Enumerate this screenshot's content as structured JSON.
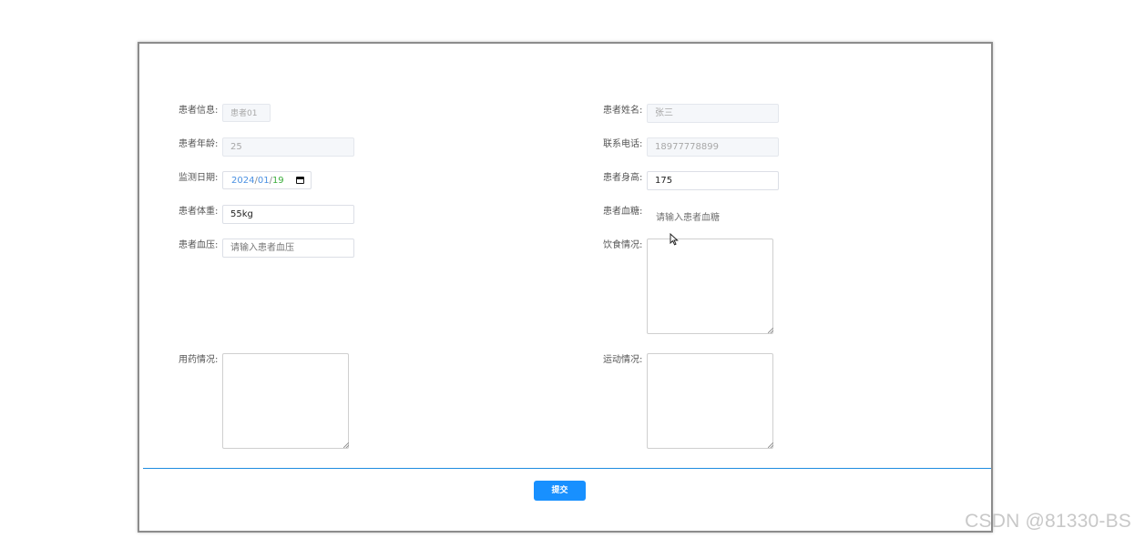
{
  "form": {
    "patient_info": {
      "label": "患者信息:",
      "value": "患者01"
    },
    "patient_name": {
      "label": "患者姓名:",
      "value": "张三"
    },
    "patient_age": {
      "label": "患者年龄:",
      "value": "25"
    },
    "contact_phone": {
      "label": "联系电话:",
      "value": "18977778899"
    },
    "monitor_date": {
      "label": "监测日期:",
      "year": "2024",
      "month": "01",
      "day": "19",
      "separator": "/"
    },
    "patient_height": {
      "label": "患者身高:",
      "value": "175"
    },
    "patient_weight": {
      "label": "患者体重:",
      "value": "55kg"
    },
    "blood_sugar": {
      "label": "患者血糖:",
      "placeholder": "请输入患者血糖"
    },
    "blood_pressure": {
      "label": "患者血压:",
      "placeholder": "请输入患者血压"
    },
    "diet": {
      "label": "饮食情况:",
      "value": ""
    },
    "medication": {
      "label": "用药情况:",
      "value": ""
    },
    "exercise": {
      "label": "运动情况:",
      "value": ""
    }
  },
  "actions": {
    "submit_label": "提交"
  },
  "icons": {
    "date_picker": "calendar-icon",
    "pointer": "mouse-cursor-icon"
  },
  "colors": {
    "accent": "#1890ff",
    "divider": "#1d8ce0"
  },
  "watermark": "CSDN @81330-BS"
}
